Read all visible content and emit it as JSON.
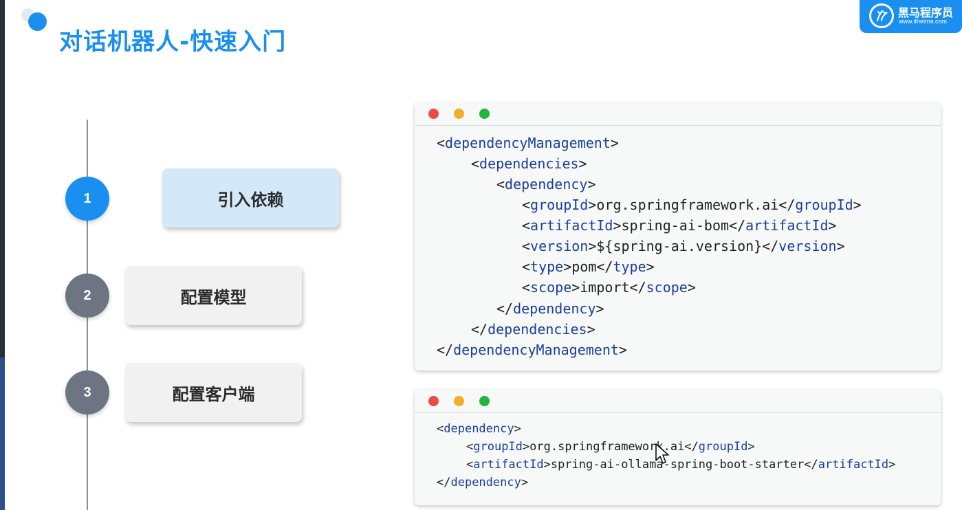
{
  "slide": {
    "title": "对话机器人-快速入门"
  },
  "logo": {
    "name": "黑马程序员",
    "site": "www.itheima.com"
  },
  "steps": [
    {
      "number": "1",
      "label": "引入依赖",
      "active": true
    },
    {
      "number": "2",
      "label": "配置模型",
      "active": false
    },
    {
      "number": "3",
      "label": "配置客户端",
      "active": false
    }
  ],
  "code_window_1": {
    "lines": [
      [
        [
          "t",
          "<"
        ],
        [
          "k",
          "dependencyManagement"
        ],
        [
          "t",
          ">"
        ]
      ],
      [
        [
          "t",
          "<"
        ],
        [
          "k",
          "dependencies"
        ],
        [
          "t",
          ">"
        ]
      ],
      [
        [
          "t",
          "<"
        ],
        [
          "k",
          "dependency"
        ],
        [
          "t",
          ">"
        ]
      ],
      [
        [
          "t",
          "<"
        ],
        [
          "k",
          "groupId"
        ],
        [
          "t",
          ">org.springframework.ai</"
        ],
        [
          "k",
          "groupId"
        ],
        [
          "t",
          ">"
        ]
      ],
      [
        [
          "t",
          "<"
        ],
        [
          "k",
          "artifactId"
        ],
        [
          "t",
          ">spring-ai-bom</"
        ],
        [
          "k",
          "artifactId"
        ],
        [
          "t",
          ">"
        ]
      ],
      [
        [
          "t",
          "<"
        ],
        [
          "k",
          "version"
        ],
        [
          "t",
          ">${spring-ai.version}</"
        ],
        [
          "k",
          "version"
        ],
        [
          "t",
          ">"
        ]
      ],
      [
        [
          "t",
          "<"
        ],
        [
          "k",
          "type"
        ],
        [
          "t",
          ">pom</"
        ],
        [
          "k",
          "type"
        ],
        [
          "t",
          ">"
        ]
      ],
      [
        [
          "t",
          "<"
        ],
        [
          "k",
          "scope"
        ],
        [
          "t",
          ">import</"
        ],
        [
          "k",
          "scope"
        ],
        [
          "t",
          ">"
        ]
      ],
      [
        [
          "t",
          "</"
        ],
        [
          "k",
          "dependency"
        ],
        [
          "t",
          ">"
        ]
      ],
      [
        [
          "t",
          "</"
        ],
        [
          "k",
          "dependencies"
        ],
        [
          "t",
          ">"
        ]
      ],
      [
        [
          "t",
          "</"
        ],
        [
          "k",
          "dependencyManagement"
        ],
        [
          "t",
          ">"
        ]
      ]
    ]
  },
  "code_window_2": {
    "lines": [
      [
        [
          "t",
          "<"
        ],
        [
          "k",
          "dependency"
        ],
        [
          "t",
          ">"
        ]
      ],
      [
        [
          "t",
          "<"
        ],
        [
          "k",
          "groupId"
        ],
        [
          "t",
          ">org.springframework.ai</"
        ],
        [
          "k",
          "groupId"
        ],
        [
          "t",
          ">"
        ]
      ],
      [
        [
          "t",
          "<"
        ],
        [
          "k",
          "artifactId"
        ],
        [
          "t",
          ">spring-ai-ollama-spring-boot-starter</"
        ],
        [
          "k",
          "artifactId"
        ],
        [
          "t",
          ">"
        ]
      ],
      [
        [
          "t",
          "</"
        ],
        [
          "k",
          "dependency"
        ],
        [
          "t",
          ">"
        ]
      ]
    ]
  },
  "colors": {
    "accent": "#1a8ff0",
    "tag": "#1a3d9e",
    "step_inactive": "#6e7481",
    "card_active": "#d3e9fa"
  }
}
